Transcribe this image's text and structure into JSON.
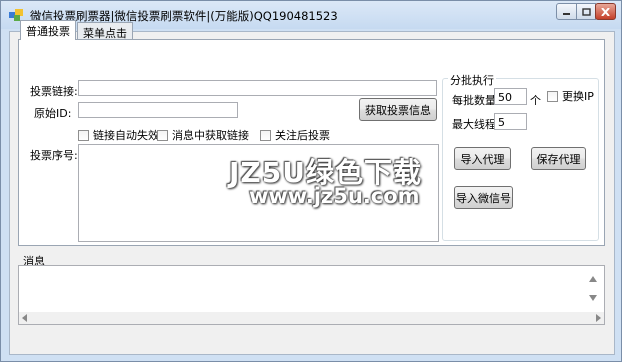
{
  "window": {
    "title": "微信投票刷票器|微信投票刷票软件|(万能版)QQ190481523"
  },
  "tabs": [
    {
      "label": "普通投票",
      "active": true
    },
    {
      "label": "菜单点击",
      "active": false
    }
  ],
  "form": {
    "vote_link_label": "投票链接:",
    "vote_link_value": "",
    "original_id_label": "原始ID:",
    "original_id_value": "",
    "get_vote_info_button": "获取投票信息",
    "checkbox_link_auto_fail": "链接自动失效",
    "checkbox_get_link_in_msg": "消息中获取链接",
    "checkbox_vote_after_follow": "关注后投票",
    "vote_serial_label": "投票序号:"
  },
  "batch": {
    "group_title": "分批执行",
    "batch_count_label": "每批数量",
    "batch_count_value": "50",
    "batch_count_unit": "个",
    "change_ip_label": "更换IP",
    "max_threads_label": "最大线程",
    "max_threads_value": "5",
    "import_proxy_button": "导入代理",
    "save_proxy_button": "保存代理",
    "import_wechat_button": "导入微信号"
  },
  "messages": {
    "label": "消息"
  },
  "watermark": {
    "line1": "JZ5U绿色下载",
    "line2": "www.jz5u.com"
  },
  "icons": {
    "min": "minimize-icon",
    "max": "maximize-icon",
    "close": "close-icon"
  }
}
